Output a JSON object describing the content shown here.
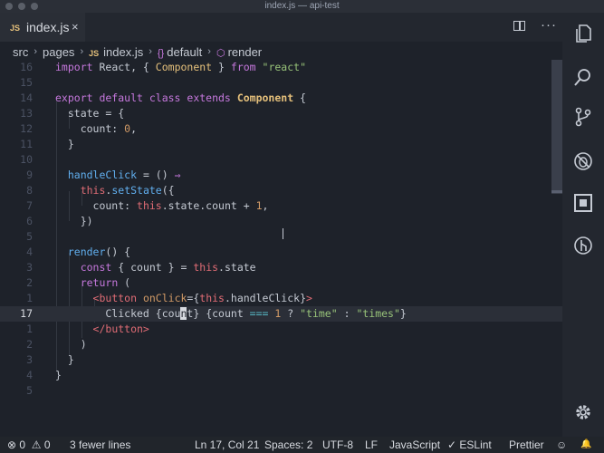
{
  "window": {
    "title": "index.js — api-test"
  },
  "tab": {
    "badge": "JS",
    "label": "index.js",
    "close": "×"
  },
  "toolbar": {
    "more": "···"
  },
  "breadcrumb": {
    "src": "src",
    "pages": "pages",
    "file_badge": "JS",
    "file": "index.js",
    "symbol_icon": "{}",
    "default": "default",
    "render": "render"
  },
  "editor": {
    "current_line": 17,
    "lines": [
      {
        "n": "16"
      },
      {
        "n": "15"
      },
      {
        "n": "14"
      },
      {
        "n": "13"
      },
      {
        "n": "12"
      },
      {
        "n": "11"
      },
      {
        "n": "10"
      },
      {
        "n": "9"
      },
      {
        "n": "8"
      },
      {
        "n": "7"
      },
      {
        "n": "6"
      },
      {
        "n": "5"
      },
      {
        "n": "4"
      },
      {
        "n": "3"
      },
      {
        "n": "2"
      },
      {
        "n": "1"
      },
      {
        "n": "17"
      },
      {
        "n": "1"
      },
      {
        "n": "2"
      },
      {
        "n": "3"
      },
      {
        "n": "4"
      },
      {
        "n": "5"
      }
    ]
  },
  "activity_icons": [
    "files-icon",
    "search-icon",
    "source-control-icon",
    "debug-icon",
    "extensions-icon",
    "gitlens-icon",
    "settings-gear-icon"
  ],
  "status": {
    "errors": "0",
    "warnings": "0",
    "message": "3 fewer lines",
    "position": "Ln 17, Col 21",
    "spaces": "Spaces: 2",
    "encoding": "UTF-8",
    "eol": "LF",
    "language": "JavaScript",
    "eslint_check": "✓",
    "eslint": "ESLint",
    "prettier": "Prettier",
    "smiley": "☺",
    "bell": "🔔"
  },
  "colors": {
    "background": "#1e222a",
    "keyword": "#c678dd",
    "class": "#e5c07b",
    "string": "#98c379",
    "number": "#d19a66",
    "this": "#e06c75"
  }
}
